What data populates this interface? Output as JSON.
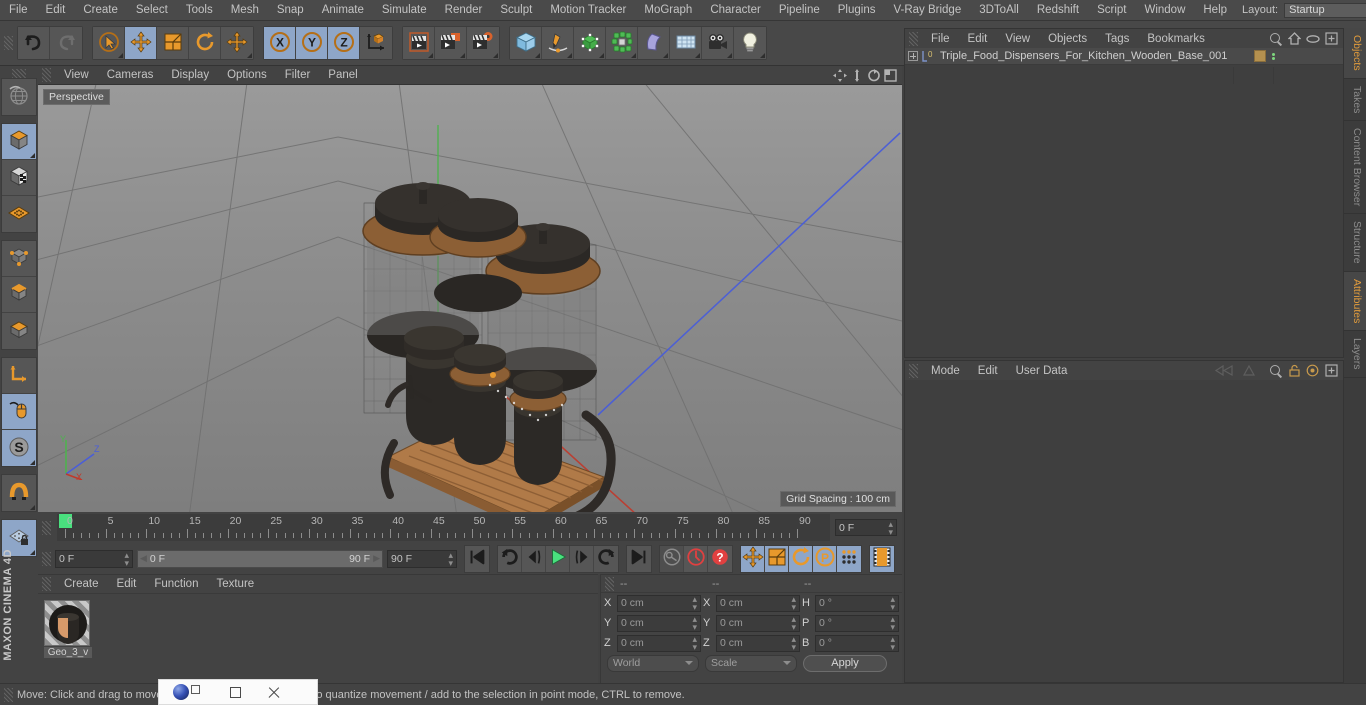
{
  "app": {
    "brand": "MAXON CINEMA 4D"
  },
  "menubar": {
    "items": [
      "File",
      "Edit",
      "Create",
      "Select",
      "Tools",
      "Mesh",
      "Snap",
      "Animate",
      "Simulate",
      "Render",
      "Sculpt",
      "Motion Tracker",
      "MoGraph",
      "Character",
      "Pipeline",
      "Plugins",
      "V-Ray Bridge",
      "3DToAll",
      "Redshift",
      "Script",
      "Window",
      "Help"
    ],
    "layout_label": "Layout:",
    "layout_value": "Startup",
    "search_icon": "search-icon"
  },
  "toolbar": {
    "groups": [
      {
        "name": "history",
        "buttons": [
          {
            "name": "undo-button",
            "icon": "undo-icon",
            "state": "normal"
          },
          {
            "name": "redo-button",
            "icon": "redo-icon",
            "state": "disabled"
          }
        ]
      },
      {
        "name": "transform",
        "buttons": [
          {
            "name": "live-selection-tool",
            "icon": "cursor-circle-icon",
            "state": "normal"
          },
          {
            "name": "move-tool",
            "icon": "move-arrows-icon",
            "state": "active"
          },
          {
            "name": "scale-tool",
            "icon": "scale-box-icon",
            "state": "normal"
          },
          {
            "name": "rotate-tool",
            "icon": "rotate-arc-icon",
            "state": "normal"
          },
          {
            "name": "move-axis-tool",
            "icon": "move-arrows-icon",
            "state": "normal"
          }
        ]
      },
      {
        "name": "axis-locks",
        "buttons": [
          {
            "name": "lock-x-axis",
            "icon": "x-axis-icon",
            "state": "active"
          },
          {
            "name": "lock-y-axis",
            "icon": "y-axis-icon",
            "state": "active"
          },
          {
            "name": "lock-z-axis",
            "icon": "z-axis-icon",
            "state": "active"
          },
          {
            "name": "coordinate-system-toggle",
            "icon": "world-object-axis-icon",
            "state": "normal"
          }
        ]
      },
      {
        "name": "render",
        "buttons": [
          {
            "name": "render-view-button",
            "icon": "clapper-icon",
            "state": "normal"
          },
          {
            "name": "render-to-picture-viewer-button",
            "icon": "clapper-picture-icon",
            "state": "normal"
          },
          {
            "name": "render-settings-button",
            "icon": "clapper-gear-icon",
            "state": "normal"
          }
        ]
      },
      {
        "name": "create",
        "buttons": [
          {
            "name": "add-cube-button",
            "icon": "cube-icon",
            "state": "normal"
          },
          {
            "name": "add-spline-button",
            "icon": "pen-spline-icon",
            "state": "normal"
          },
          {
            "name": "add-generator-button",
            "icon": "green-cube-generator-icon",
            "state": "normal"
          },
          {
            "name": "add-array-button",
            "icon": "green-cluster-icon",
            "state": "normal"
          },
          {
            "name": "add-deformer-button",
            "icon": "bend-deformer-icon",
            "state": "normal"
          },
          {
            "name": "add-environment-button",
            "icon": "floor-environment-icon",
            "state": "normal"
          },
          {
            "name": "add-camera-button",
            "icon": "camera-icon",
            "state": "normal"
          },
          {
            "name": "add-light-button",
            "icon": "light-bulb-icon",
            "state": "normal"
          }
        ]
      }
    ]
  },
  "left_toolbar": {
    "buttons": [
      {
        "name": "undo-view-button",
        "icon": "globe-wire-icon",
        "state": "normal"
      },
      {
        "name": "model-mode-button",
        "icon": "model-cube-icon",
        "state": "active"
      },
      {
        "name": "texture-mode-button",
        "icon": "checker-cube-icon",
        "state": "normal"
      },
      {
        "name": "workplane-mode-button",
        "icon": "orange-grid-icon",
        "state": "normal"
      },
      {
        "name": "points-mode-button",
        "icon": "points-cube-icon",
        "state": "normal"
      },
      {
        "name": "edges-mode-button",
        "icon": "edges-cube-icon",
        "state": "normal"
      },
      {
        "name": "polygons-mode-button",
        "icon": "polygons-cube-icon",
        "state": "normal"
      },
      {
        "name": "enable-axis-button",
        "icon": "axis-l-icon",
        "state": "normal"
      },
      {
        "name": "viewport-solo-button",
        "icon": "mouse-icon",
        "state": "active"
      },
      {
        "name": "snap-button",
        "icon": "snap-s-icon",
        "state": "active"
      },
      {
        "name": "magnet-button",
        "icon": "magnet-icon",
        "state": "normal"
      },
      {
        "name": "workplane-lock-button",
        "icon": "grid-lock-icon",
        "state": "active"
      }
    ]
  },
  "viewport": {
    "menu": [
      "View",
      "Cameras",
      "Display",
      "Options",
      "Filter",
      "Panel"
    ],
    "perspective_label": "Perspective",
    "grid_spacing": "Grid Spacing : 100 cm",
    "axis_labels": {
      "x": "X",
      "y": "Y",
      "z": "Z"
    }
  },
  "timeline": {
    "ticks": [
      0,
      5,
      10,
      15,
      20,
      25,
      30,
      35,
      40,
      45,
      50,
      55,
      60,
      65,
      70,
      75,
      80,
      85,
      90
    ],
    "min": 0,
    "max": 90,
    "playhead_frame": 0,
    "current_frame_field": "0 F"
  },
  "transport": {
    "start_frame": "0 F",
    "range_start": "0 F",
    "range_end": "90 F",
    "end_frame": "90 F",
    "buttons": [
      {
        "name": "go-to-start-button",
        "icon": "skip-start-icon"
      },
      {
        "name": "previous-keyframe-button",
        "icon": "arc-back-icon"
      },
      {
        "name": "previous-frame-button",
        "icon": "step-back-icon"
      },
      {
        "name": "play-button",
        "icon": "play-icon"
      },
      {
        "name": "next-frame-button",
        "icon": "step-forward-icon"
      },
      {
        "name": "next-keyframe-button",
        "icon": "arc-forward-icon"
      },
      {
        "name": "go-to-end-button",
        "icon": "skip-end-icon"
      },
      {
        "name": "record-active-objects-button",
        "icon": "key-icon"
      },
      {
        "name": "autokeying-button",
        "icon": "red-circle-icon"
      },
      {
        "name": "keyframe-selection-button",
        "icon": "red-question-icon"
      },
      {
        "name": "position-key-toggle",
        "icon": "move-arrows-icon"
      },
      {
        "name": "scale-key-toggle",
        "icon": "scale-box-icon"
      },
      {
        "name": "rotation-key-toggle",
        "icon": "rotate-arc-icon"
      },
      {
        "name": "param-key-toggle",
        "icon": "p-circle-icon"
      },
      {
        "name": "pla-key-toggle",
        "icon": "dots-grid-icon"
      },
      {
        "name": "timeline-strip-button",
        "icon": "film-strip-icon"
      }
    ]
  },
  "material_manager": {
    "menu": [
      "Create",
      "Edit",
      "Function",
      "Texture"
    ],
    "materials": [
      {
        "name": "Geo_3_v"
      }
    ]
  },
  "coordinates": {
    "header": [
      "--",
      "--",
      "--"
    ],
    "position": {
      "label_x": "X",
      "label_y": "Y",
      "label_z": "Z",
      "x": "0 cm",
      "y": "0 cm",
      "z": "0 cm"
    },
    "size": {
      "label_x": "X",
      "label_y": "Y",
      "label_z": "Z",
      "x": "0 cm",
      "y": "0 cm",
      "z": "0 cm"
    },
    "rotation": {
      "label_h": "H",
      "label_p": "P",
      "label_b": "B",
      "h": "0 °",
      "p": "0 °",
      "b": "0 °"
    },
    "system": "World",
    "mode": "Scale",
    "apply_label": "Apply"
  },
  "object_manager": {
    "menu": [
      "File",
      "Edit",
      "View",
      "Objects",
      "Tags",
      "Bookmarks"
    ],
    "icons": [
      "search-icon",
      "home-icon",
      "ellipse-icon",
      "plus-box-icon"
    ],
    "object": {
      "name": "Triple_Food_Dispensers_For_Kitchen_Wooden_Base_001",
      "layer_badge": "0",
      "material_tag_color": "#b5914f"
    }
  },
  "attributes": {
    "menu": [
      "Mode",
      "Edit",
      "User Data"
    ],
    "icons": [
      "keyframe-left-icon",
      "keyframe-right-icon",
      "search-icon",
      "lock-icon",
      "target-icon",
      "plus-box-icon"
    ]
  },
  "tabstrip": {
    "tabs": [
      {
        "label": "Objects",
        "active": true
      },
      {
        "label": "Takes",
        "active": false
      },
      {
        "label": "Content Browser",
        "active": false
      },
      {
        "label": "Structure",
        "active": false
      },
      {
        "label": "Attributes",
        "active": true
      },
      {
        "label": "Layers",
        "active": false
      }
    ]
  },
  "statusbar": {
    "text": "Move: Click and drag to move the selected elements, SHIFT to quantize movement / add to the selection in point mode, CTRL to remove."
  },
  "overlay_window": {
    "logo_icon": "app-logo-icon",
    "restore_icon": "restore-icon",
    "minimize_icon": "minimize-icon",
    "close_icon": "close-icon"
  }
}
